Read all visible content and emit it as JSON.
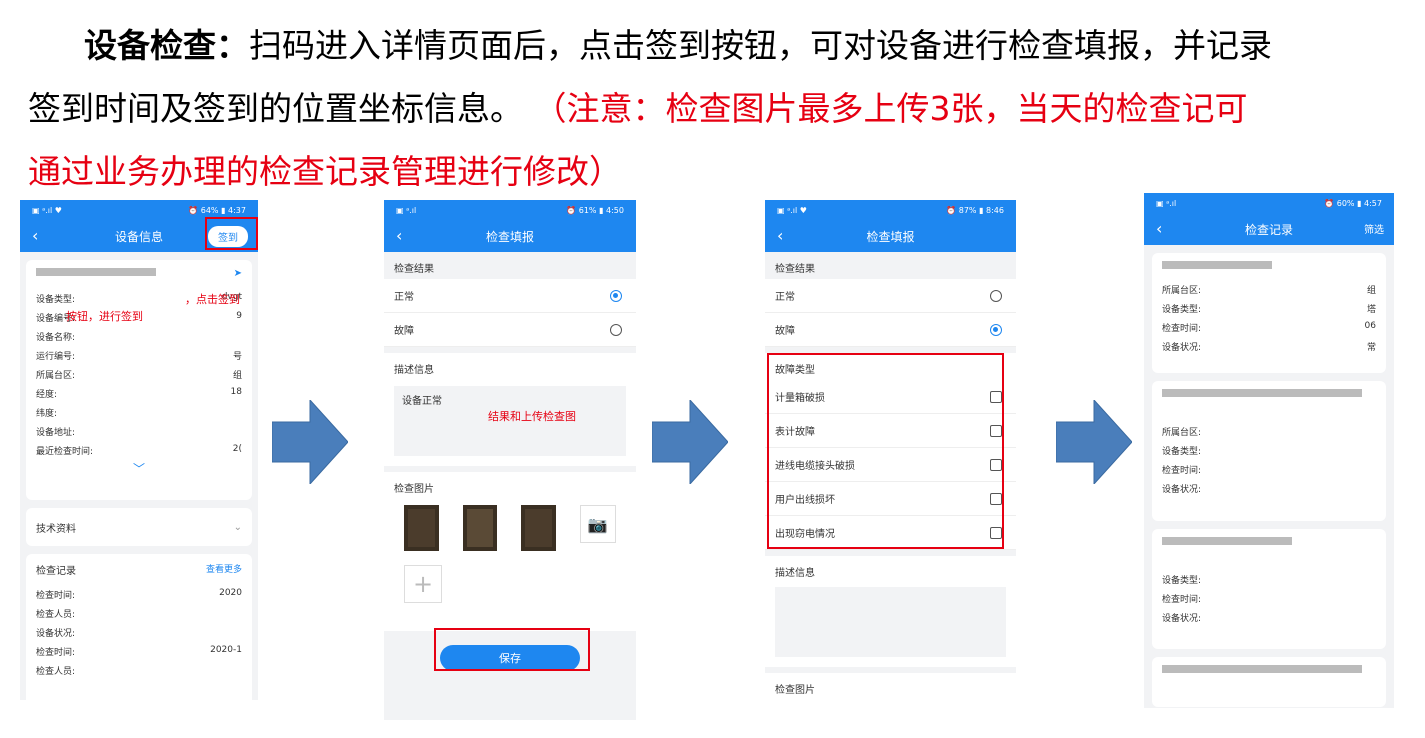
{
  "slide": {
    "bold_label": "设备检查：",
    "line1": "扫码进入详情页面后，点击签到按钮，可对设备进行检查填报，并记录",
    "line2": "签到时间及签到的位置坐标信息。",
    "note_line1": "（注意：检查图片最多上传3张，当天的检查记可",
    "note_line2": "通过业务办理的检查记录管理进行修改）"
  },
  "screen1": {
    "status_left": "▣ ᵃ.ıl ♥",
    "status_right": "⏰ 64% ▮ 4:37",
    "title": "设备信息",
    "signin_label": "签到",
    "annotation_a": "，点击签到",
    "annotation_b": "按钮，进行签到",
    "fields": [
      {
        "label": "设备类型:",
        "value": "dvgt"
      },
      {
        "label": "设备编号:",
        "value": "9"
      },
      {
        "label": "设备名称:",
        "value": ""
      },
      {
        "label": "运行编号:",
        "value": "号"
      },
      {
        "label": "所属台区:",
        "value": "组"
      },
      {
        "label": "经度:",
        "value": "18"
      },
      {
        "label": "纬度:",
        "value": ""
      },
      {
        "label": "设备地址:",
        "value": ""
      },
      {
        "label": "最近检查时间:",
        "value": "2("
      }
    ],
    "tech_label": "技术资料",
    "records_label": "检查记录",
    "more_label": "查看更多",
    "rec_rows": [
      {
        "label": "检查时间:",
        "value": "2020"
      },
      {
        "label": "检查人员:",
        "value": ""
      },
      {
        "label": "设备状况:",
        "value": ""
      },
      {
        "label": "检查时间:",
        "value": "2020-1"
      },
      {
        "label": "检查人员:",
        "value": ""
      }
    ]
  },
  "screen2": {
    "status_left": "▣ ᵃ.ıl",
    "status_right": "⏰ 61% ▮ 4:50",
    "title": "检查填报",
    "result_label": "检查结果",
    "normal_label": "正常",
    "fault_label": "故障",
    "desc_label": "描述信息",
    "desc_value": "设备正常",
    "annotation": "结果和上传检查图",
    "photos_label": "检查图片",
    "save_label": "保存"
  },
  "screen3": {
    "status_left": "▣ ᵃ.ıl ♥",
    "status_right": "⏰ 87% ▮ 8:46",
    "title": "检查填报",
    "result_label": "检查结果",
    "normal_label": "正常",
    "fault_label": "故障",
    "fault_type_label": "故障类型",
    "fault_types": [
      "计量箱破损",
      "表计故障",
      "进线电缆接头破损",
      "用户出线损坏",
      "出现窃电情况"
    ],
    "desc_label": "描述信息",
    "photos_label": "检查图片"
  },
  "screen4": {
    "status_left": "▣ ᵃ.ıl",
    "status_right": "⏰ 60% ▮ 4:57",
    "title": "检查记录",
    "filter_label": "筛选",
    "card1": [
      {
        "label": "所属台区:",
        "value": "组"
      },
      {
        "label": "设备类型:",
        "value": "塔"
      },
      {
        "label": "检查时间:",
        "value": "06"
      },
      {
        "label": "设备状况:",
        "value": "常"
      }
    ],
    "card2": [
      {
        "label": "所属台区:",
        "value": ""
      },
      {
        "label": "设备类型:",
        "value": ""
      },
      {
        "label": "检查时间:",
        "value": ""
      },
      {
        "label": "设备状况:",
        "value": ""
      }
    ],
    "card3": [
      {
        "label": "设备类型:",
        "value": ""
      },
      {
        "label": "检查时间:",
        "value": ""
      },
      {
        "label": "设备状况:",
        "value": ""
      }
    ]
  },
  "colors": {
    "primary": "#1e87f0",
    "highlight_red": "#e60012",
    "arrow_blue": "#4a7ebb"
  }
}
